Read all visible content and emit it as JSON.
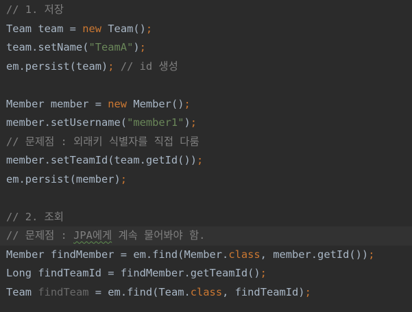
{
  "code": {
    "l1": {
      "a": "// 1. 저장"
    },
    "l2": {
      "a": "Team team = ",
      "b": "new",
      "c": " Team()",
      "d": ";"
    },
    "l3": {
      "a": "team.setName(",
      "b": "\"TeamA\"",
      "c": ")",
      "d": ";"
    },
    "l4": {
      "a": "em.persist(team)",
      "b": ";",
      "c": " // id 생성"
    },
    "l6": {
      "a": "Member member = ",
      "b": "new",
      "c": " Member()",
      "d": ";"
    },
    "l7": {
      "a": "member.setUsername(",
      "b": "\"member1\"",
      "c": ")",
      "d": ";"
    },
    "l8": {
      "a": "// 문제점 : 외래키 식별자를 직접 다룸"
    },
    "l9": {
      "a": "member.setTeamId(team.getId())",
      "b": ";"
    },
    "l10": {
      "a": "em.persist(member)",
      "b": ";"
    },
    "l12": {
      "a": "// 2. 조회"
    },
    "l13": {
      "a": "// 문제점 : ",
      "b": "JPA에게",
      "c": " 계속 물어봐야 함."
    },
    "l14": {
      "a": "Member findMember = em.find(Member.",
      "b": "class",
      "c": ", member.getId())",
      "d": ";"
    },
    "l15": {
      "a": "Long findTeamId = findMember.getTeamId()",
      "b": ";"
    },
    "l16": {
      "a": "Team ",
      "b": "findTeam",
      "c": " = em.find(Team.",
      "d": "class",
      "e": ", findTeamId)",
      "f": ";"
    }
  },
  "colors": {
    "background": "#2b2b2b",
    "current_line": "#323232",
    "text": "#a9b7c6",
    "keyword": "#cc7832",
    "string": "#6a8759",
    "comment": "#808080",
    "unused": "#6a6a6a"
  }
}
